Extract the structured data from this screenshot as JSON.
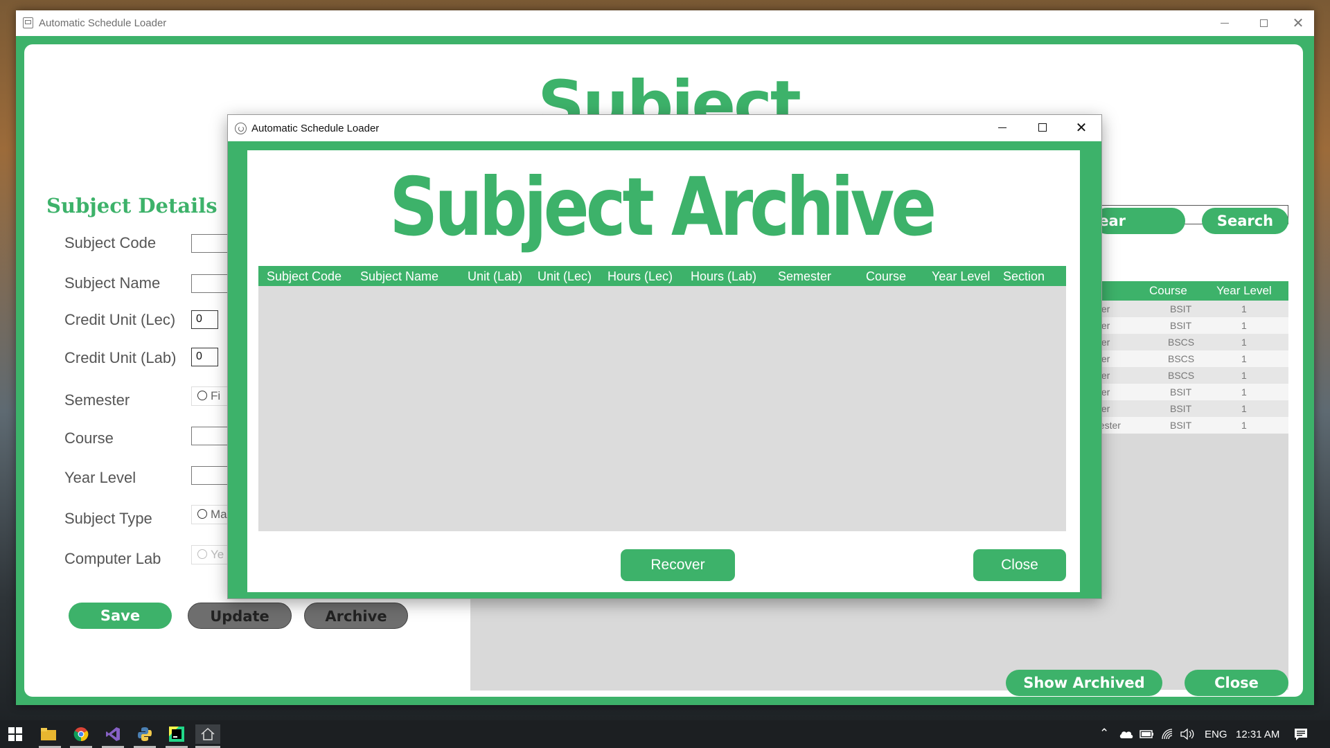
{
  "main_window": {
    "title": "Automatic Schedule Loader",
    "heading": "Subject",
    "details_heading": "Subject Details",
    "fields": {
      "subject_code": "Subject Code",
      "subject_name": "Subject Name",
      "credit_unit_lec": "Credit Unit (Lec)",
      "credit_unit_lec_value": "0",
      "credit_unit_lab": "Credit Unit (Lab)",
      "credit_unit_lab_value": "0",
      "semester": "Semester",
      "semester_option": "Fi",
      "course": "Course",
      "year_level": "Year Level",
      "subject_type": "Subject Type",
      "subject_type_option": "Ma",
      "computer_lab": "Computer Lab",
      "computer_lab_option": "Ye"
    },
    "buttons": {
      "save": "Save",
      "update": "Update",
      "archive": "Archive",
      "clear": "lear",
      "search": "Search",
      "show_archived": "Show Archived",
      "close": "Close"
    },
    "table": {
      "headers": [
        "r",
        "Course",
        "Year Level"
      ],
      "rows": [
        [
          "ster",
          "BSIT",
          "1"
        ],
        [
          "ster",
          "BSIT",
          "1"
        ],
        [
          "ster",
          "BSCS",
          "1"
        ],
        [
          "ster",
          "BSCS",
          "1"
        ],
        [
          "ster",
          "BSCS",
          "1"
        ],
        [
          "ster",
          "BSIT",
          "1"
        ],
        [
          "ster",
          "BSIT",
          "1"
        ],
        [
          "nester",
          "BSIT",
          "1"
        ]
      ]
    }
  },
  "archive_dialog": {
    "title": "Automatic Schedule Loader",
    "heading": "Subject Archive",
    "columns": [
      "Subject Code",
      "Subject Name",
      "Unit (Lab)",
      "Unit (Lec)",
      "Hours (Lec)",
      "Hours (Lab)",
      "Semester",
      "Course",
      "Year Level",
      "Section"
    ],
    "buttons": {
      "recover": "Recover",
      "close": "Close"
    }
  },
  "taskbar": {
    "apps": [
      "file-explorer",
      "chrome",
      "visual-studio",
      "python",
      "pycharm",
      "home"
    ],
    "language": "ENG",
    "time": "12:31 AM"
  },
  "colors": {
    "accent_green": "#3db26a",
    "table_bg": "#d9d9d9",
    "taskbar": "#1c1f22"
  }
}
